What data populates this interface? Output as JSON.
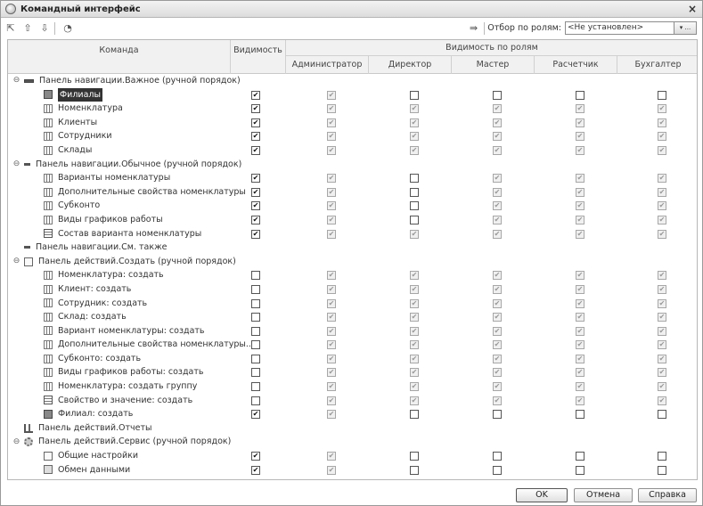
{
  "window": {
    "title": "Командный интерфейс",
    "close": "×"
  },
  "toolbar": {
    "icons": [
      "move-to-group-icon",
      "move-up-icon",
      "move-down-icon",
      "settings-icon"
    ]
  },
  "filter": {
    "label": "Отбор по ролям:",
    "value": "<Не установлен>",
    "btn": "▾ ..."
  },
  "header": {
    "command": "Команда",
    "visibility": "Видимость",
    "roles_group": "Видимость по ролям",
    "roles": [
      "Администратор",
      "Директор",
      "Мастер",
      "Расчетчик",
      "Бухгалтер"
    ]
  },
  "rows": [
    {
      "level": 0,
      "icon": "group",
      "expand": "⊖",
      "label": "Панель навигации.Важное (ручной порядок)"
    },
    {
      "level": 1,
      "icon": "org",
      "label": "Филиалы",
      "selected": true,
      "vis": true,
      "roles": [
        1,
        0,
        0,
        0,
        0
      ]
    },
    {
      "level": 1,
      "icon": "tbl",
      "label": "Номенклатура",
      "vis": true,
      "roles": [
        1,
        1,
        1,
        1,
        1
      ]
    },
    {
      "level": 1,
      "icon": "tbl",
      "label": "Клиенты",
      "vis": true,
      "roles": [
        1,
        1,
        1,
        1,
        1
      ]
    },
    {
      "level": 1,
      "icon": "tbl",
      "label": "Сотрудники",
      "vis": true,
      "roles": [
        1,
        1,
        1,
        1,
        1
      ]
    },
    {
      "level": 1,
      "icon": "tbl",
      "label": "Склады",
      "vis": true,
      "roles": [
        1,
        1,
        1,
        1,
        1
      ]
    },
    {
      "level": 0,
      "icon": "group2",
      "expand": "⊖",
      "label": "Панель навигации.Обычное (ручной порядок)"
    },
    {
      "level": 1,
      "icon": "tbl",
      "label": "Варианты номенклатуры",
      "vis": true,
      "roles": [
        1,
        0,
        1,
        1,
        1
      ]
    },
    {
      "level": 1,
      "icon": "tbl",
      "label": "Дополнительные свойства номенклатуры",
      "vis": true,
      "roles": [
        1,
        0,
        1,
        1,
        1
      ]
    },
    {
      "level": 1,
      "icon": "tbl",
      "label": "Субконто",
      "vis": true,
      "roles": [
        1,
        0,
        1,
        1,
        1
      ]
    },
    {
      "level": 1,
      "icon": "tbl",
      "label": "Виды графиков работы",
      "vis": true,
      "roles": [
        1,
        0,
        1,
        1,
        1
      ]
    },
    {
      "level": 1,
      "icon": "grid4",
      "label": "Состав варианта номенклатуры",
      "vis": true,
      "roles": [
        1,
        1,
        1,
        1,
        1
      ]
    },
    {
      "level": 0,
      "icon": "group2",
      "expand": "",
      "label": "Панель навигации.См. также"
    },
    {
      "level": 0,
      "icon": "page",
      "expand": "⊖",
      "label": "Панель действий.Создать (ручной порядок)"
    },
    {
      "level": 1,
      "icon": "tbl",
      "label": "Номенклатура: создать",
      "vis": false,
      "roles": [
        1,
        1,
        1,
        1,
        1
      ]
    },
    {
      "level": 1,
      "icon": "tbl",
      "label": "Клиент: создать",
      "vis": false,
      "roles": [
        1,
        1,
        1,
        1,
        1
      ]
    },
    {
      "level": 1,
      "icon": "tbl",
      "label": "Сотрудник: создать",
      "vis": false,
      "roles": [
        1,
        1,
        1,
        1,
        1
      ]
    },
    {
      "level": 1,
      "icon": "tbl",
      "label": "Склад: создать",
      "vis": false,
      "roles": [
        1,
        1,
        1,
        1,
        1
      ]
    },
    {
      "level": 1,
      "icon": "tbl",
      "label": "Вариант номенклатуры: создать",
      "vis": false,
      "roles": [
        1,
        1,
        1,
        1,
        1
      ]
    },
    {
      "level": 1,
      "icon": "tbl",
      "label": "Дополнительные свойства номенклатуры...",
      "vis": false,
      "roles": [
        1,
        1,
        1,
        1,
        1
      ]
    },
    {
      "level": 1,
      "icon": "tbl",
      "label": "Субконто: создать",
      "vis": false,
      "roles": [
        1,
        1,
        1,
        1,
        1
      ]
    },
    {
      "level": 1,
      "icon": "tbl",
      "label": "Виды графиков работы: создать",
      "vis": false,
      "roles": [
        1,
        1,
        1,
        1,
        1
      ]
    },
    {
      "level": 1,
      "icon": "tbl",
      "label": "Номенклатура: создать группу",
      "vis": false,
      "roles": [
        1,
        1,
        1,
        1,
        1
      ]
    },
    {
      "level": 1,
      "icon": "grid4",
      "label": "Свойство и значение: создать",
      "vis": false,
      "roles": [
        1,
        1,
        1,
        1,
        1
      ]
    },
    {
      "level": 1,
      "icon": "org",
      "label": "Филиал: создать",
      "vis": true,
      "roles": [
        1,
        0,
        0,
        0,
        0
      ]
    },
    {
      "level": 0,
      "icon": "chart",
      "expand": "",
      "label": "Панель действий.Отчеты"
    },
    {
      "level": 0,
      "icon": "gear",
      "expand": "⊖",
      "label": "Панель действий.Сервис (ручной порядок)"
    },
    {
      "level": 1,
      "icon": "page",
      "label": "Общие настройки",
      "vis": true,
      "roles": [
        1,
        0,
        0,
        0,
        0
      ]
    },
    {
      "level": 1,
      "icon": "xchg",
      "label": "Обмен данными",
      "vis": true,
      "roles": [
        1,
        0,
        0,
        0,
        0
      ]
    }
  ],
  "buttons": {
    "ok": "OK",
    "cancel": "Отмена",
    "help": "Справка"
  }
}
